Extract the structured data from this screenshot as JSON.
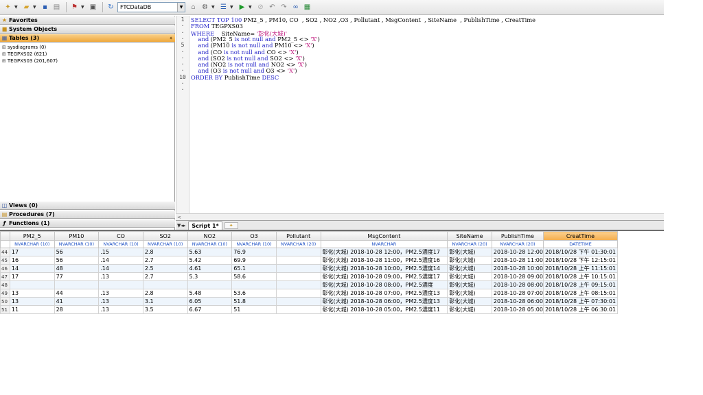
{
  "toolbar": {
    "database": "FTCDataDB",
    "icons": [
      "new-query-icon",
      "open-icon",
      "save-icon",
      "print-icon",
      "filter-icon",
      "preview-icon",
      "refresh-icon",
      "database-icon",
      "options-icon",
      "list-icon",
      "run-icon",
      "stop-icon",
      "undo-icon",
      "redo-icon",
      "binoculars-icon",
      "grid-icon"
    ]
  },
  "left_panel": {
    "favorites": "Favorites",
    "system_objects": "System Objects",
    "tables": "Tables  (3)",
    "tree": [
      "sysdiagrams  (0)",
      "TEGPXS02  (621)",
      "TEGPXS03  (201,607)"
    ],
    "views": "Views  (0)",
    "procedures": "Procedures  (7)",
    "functions": "Functions  (1)"
  },
  "editor": {
    "gutter": [
      "1",
      "·",
      "·",
      "·",
      "5",
      "·",
      "·",
      "·",
      "·",
      "10",
      "·",
      "·"
    ],
    "lines": [
      [
        [
          "kw",
          "SELECT TOP 100 "
        ],
        [
          "",
          "PM2_5 , PM10, CO  , SO2 , NO2 ,O3 , Pollutant , MsgContent  , SiteName  , PublishTime , CreatTime"
        ]
      ],
      [
        [
          "kw",
          "FROM "
        ],
        [
          "",
          "TEGPXS03"
        ]
      ],
      [
        [
          "kw",
          "WHERE"
        ],
        [
          "",
          "    SiteName= "
        ],
        [
          "str",
          "'彰化(大城)'"
        ]
      ],
      [
        [
          "kw",
          "    and "
        ],
        [
          "",
          "(PM2_5 "
        ],
        [
          "kw",
          "is not null and "
        ],
        [
          "",
          "PM2_5 <> "
        ],
        [
          "str",
          "'X'"
        ],
        [
          "",
          ")"
        ]
      ],
      [
        [
          "kw",
          "    and "
        ],
        [
          "",
          "(PM10 "
        ],
        [
          "kw",
          "is not null and "
        ],
        [
          "",
          "PM10 <> "
        ],
        [
          "str",
          "'X'"
        ],
        [
          "",
          ")"
        ]
      ],
      [
        [
          "kw",
          "    and "
        ],
        [
          "",
          "(CO "
        ],
        [
          "kw",
          "is not null and "
        ],
        [
          "",
          "CO <> "
        ],
        [
          "str",
          "'X'"
        ],
        [
          "",
          ")"
        ]
      ],
      [
        [
          "kw",
          "    and "
        ],
        [
          "",
          "(SO2 "
        ],
        [
          "kw",
          "is not null and "
        ],
        [
          "",
          "SO2 <> "
        ],
        [
          "str",
          "'X'"
        ],
        [
          "",
          ")"
        ]
      ],
      [
        [
          "kw",
          "    and "
        ],
        [
          "",
          "(NO2 "
        ],
        [
          "kw",
          "is not null and "
        ],
        [
          "",
          "NO2 <> "
        ],
        [
          "str",
          "'X'"
        ],
        [
          "",
          ")"
        ]
      ],
      [
        [
          "kw",
          "    and "
        ],
        [
          "",
          "(O3 "
        ],
        [
          "kw",
          "is not null and "
        ],
        [
          "",
          "O3 <> "
        ],
        [
          "str",
          "'X'"
        ],
        [
          "",
          ")"
        ]
      ],
      [
        [
          "kw",
          "ORDER BY "
        ],
        [
          "",
          "PublishTime "
        ],
        [
          "kw",
          "DESC"
        ]
      ]
    ]
  },
  "tabs": {
    "script_tab": "Script 1*"
  },
  "grid": {
    "columns": [
      {
        "name": "PM2_5",
        "type": "NVARCHAR (10)"
      },
      {
        "name": "PM10",
        "type": "NVARCHAR (10)"
      },
      {
        "name": "CO",
        "type": "NVARCHAR (10)"
      },
      {
        "name": "SO2",
        "type": "NVARCHAR (10)"
      },
      {
        "name": "NO2",
        "type": "NVARCHAR (10)"
      },
      {
        "name": "O3",
        "type": "NVARCHAR (10)"
      },
      {
        "name": "Pollutant",
        "type": "NVARCHAR (20)"
      },
      {
        "name": "MsgContent",
        "type": "NVARCHAR"
      },
      {
        "name": "SiteName",
        "type": "NVARCHAR (20)"
      },
      {
        "name": "PublishTime",
        "type": "NVARCHAR (20)"
      },
      {
        "name": "CreatTime",
        "type": "DATETIME"
      }
    ],
    "rows": [
      {
        "n": "44",
        "cells": [
          "17",
          "56",
          ".15",
          "2.8",
          "5.63",
          "76.9",
          "",
          "彰化(大城) 2018-10-28 12:00，PM2.5濃度17",
          "彰化(大城)",
          "2018-10-28 12:00",
          "2018/10/28 下午 01:30:01"
        ]
      },
      {
        "n": "45",
        "cells": [
          "16",
          "56",
          ".14",
          "2.7",
          "5.42",
          "69.9",
          "",
          "彰化(大城) 2018-10-28 11:00，PM2.5濃度16",
          "彰化(大城)",
          "2018-10-28 11:00",
          "2018/10/28 下午 12:15:01"
        ]
      },
      {
        "n": "46",
        "cells": [
          "14",
          "48",
          ".14",
          "2.5",
          "4.61",
          "65.1",
          "",
          "彰化(大城) 2018-10-28 10:00，PM2.5濃度14",
          "彰化(大城)",
          "2018-10-28 10:00",
          "2018/10/28 上午 11:15:01"
        ]
      },
      {
        "n": "47",
        "cells": [
          "17",
          "77",
          ".13",
          "2.7",
          "5.3",
          "58.6",
          "",
          "彰化(大城) 2018-10-28 09:00，PM2.5濃度17",
          "彰化(大城)",
          "2018-10-28 09:00",
          "2018/10/28 上午 10:15:01"
        ]
      },
      {
        "n": "48",
        "cells": [
          "",
          "",
          "",
          "",
          "",
          "",
          "",
          "彰化(大城) 2018-10-28 08:00，PM2.5濃度",
          "彰化(大城)",
          "2018-10-28 08:00",
          "2018/10/28 上午 09:15:01"
        ]
      },
      {
        "n": "49",
        "cells": [
          "13",
          "44",
          ".13",
          "2.8",
          "5.48",
          "53.6",
          "",
          "彰化(大城) 2018-10-28 07:00，PM2.5濃度13",
          "彰化(大城)",
          "2018-10-28 07:00",
          "2018/10/28 上午 08:15:01"
        ]
      },
      {
        "n": "50",
        "cells": [
          "13",
          "41",
          ".13",
          "3.1",
          "6.05",
          "51.8",
          "",
          "彰化(大城) 2018-10-28 06:00，PM2.5濃度13",
          "彰化(大城)",
          "2018-10-28 06:00",
          "2018/10/28 上午 07:30:01"
        ]
      },
      {
        "n": "51",
        "cells": [
          "11",
          "28",
          ".13",
          "3.5",
          "6.67",
          "51",
          "",
          "彰化(大城) 2018-10-28 05:00，PM2.5濃度11",
          "彰化(大城)",
          "2018-10-28 05:00",
          "2018/10/28 上午 06:30:01"
        ]
      }
    ]
  }
}
